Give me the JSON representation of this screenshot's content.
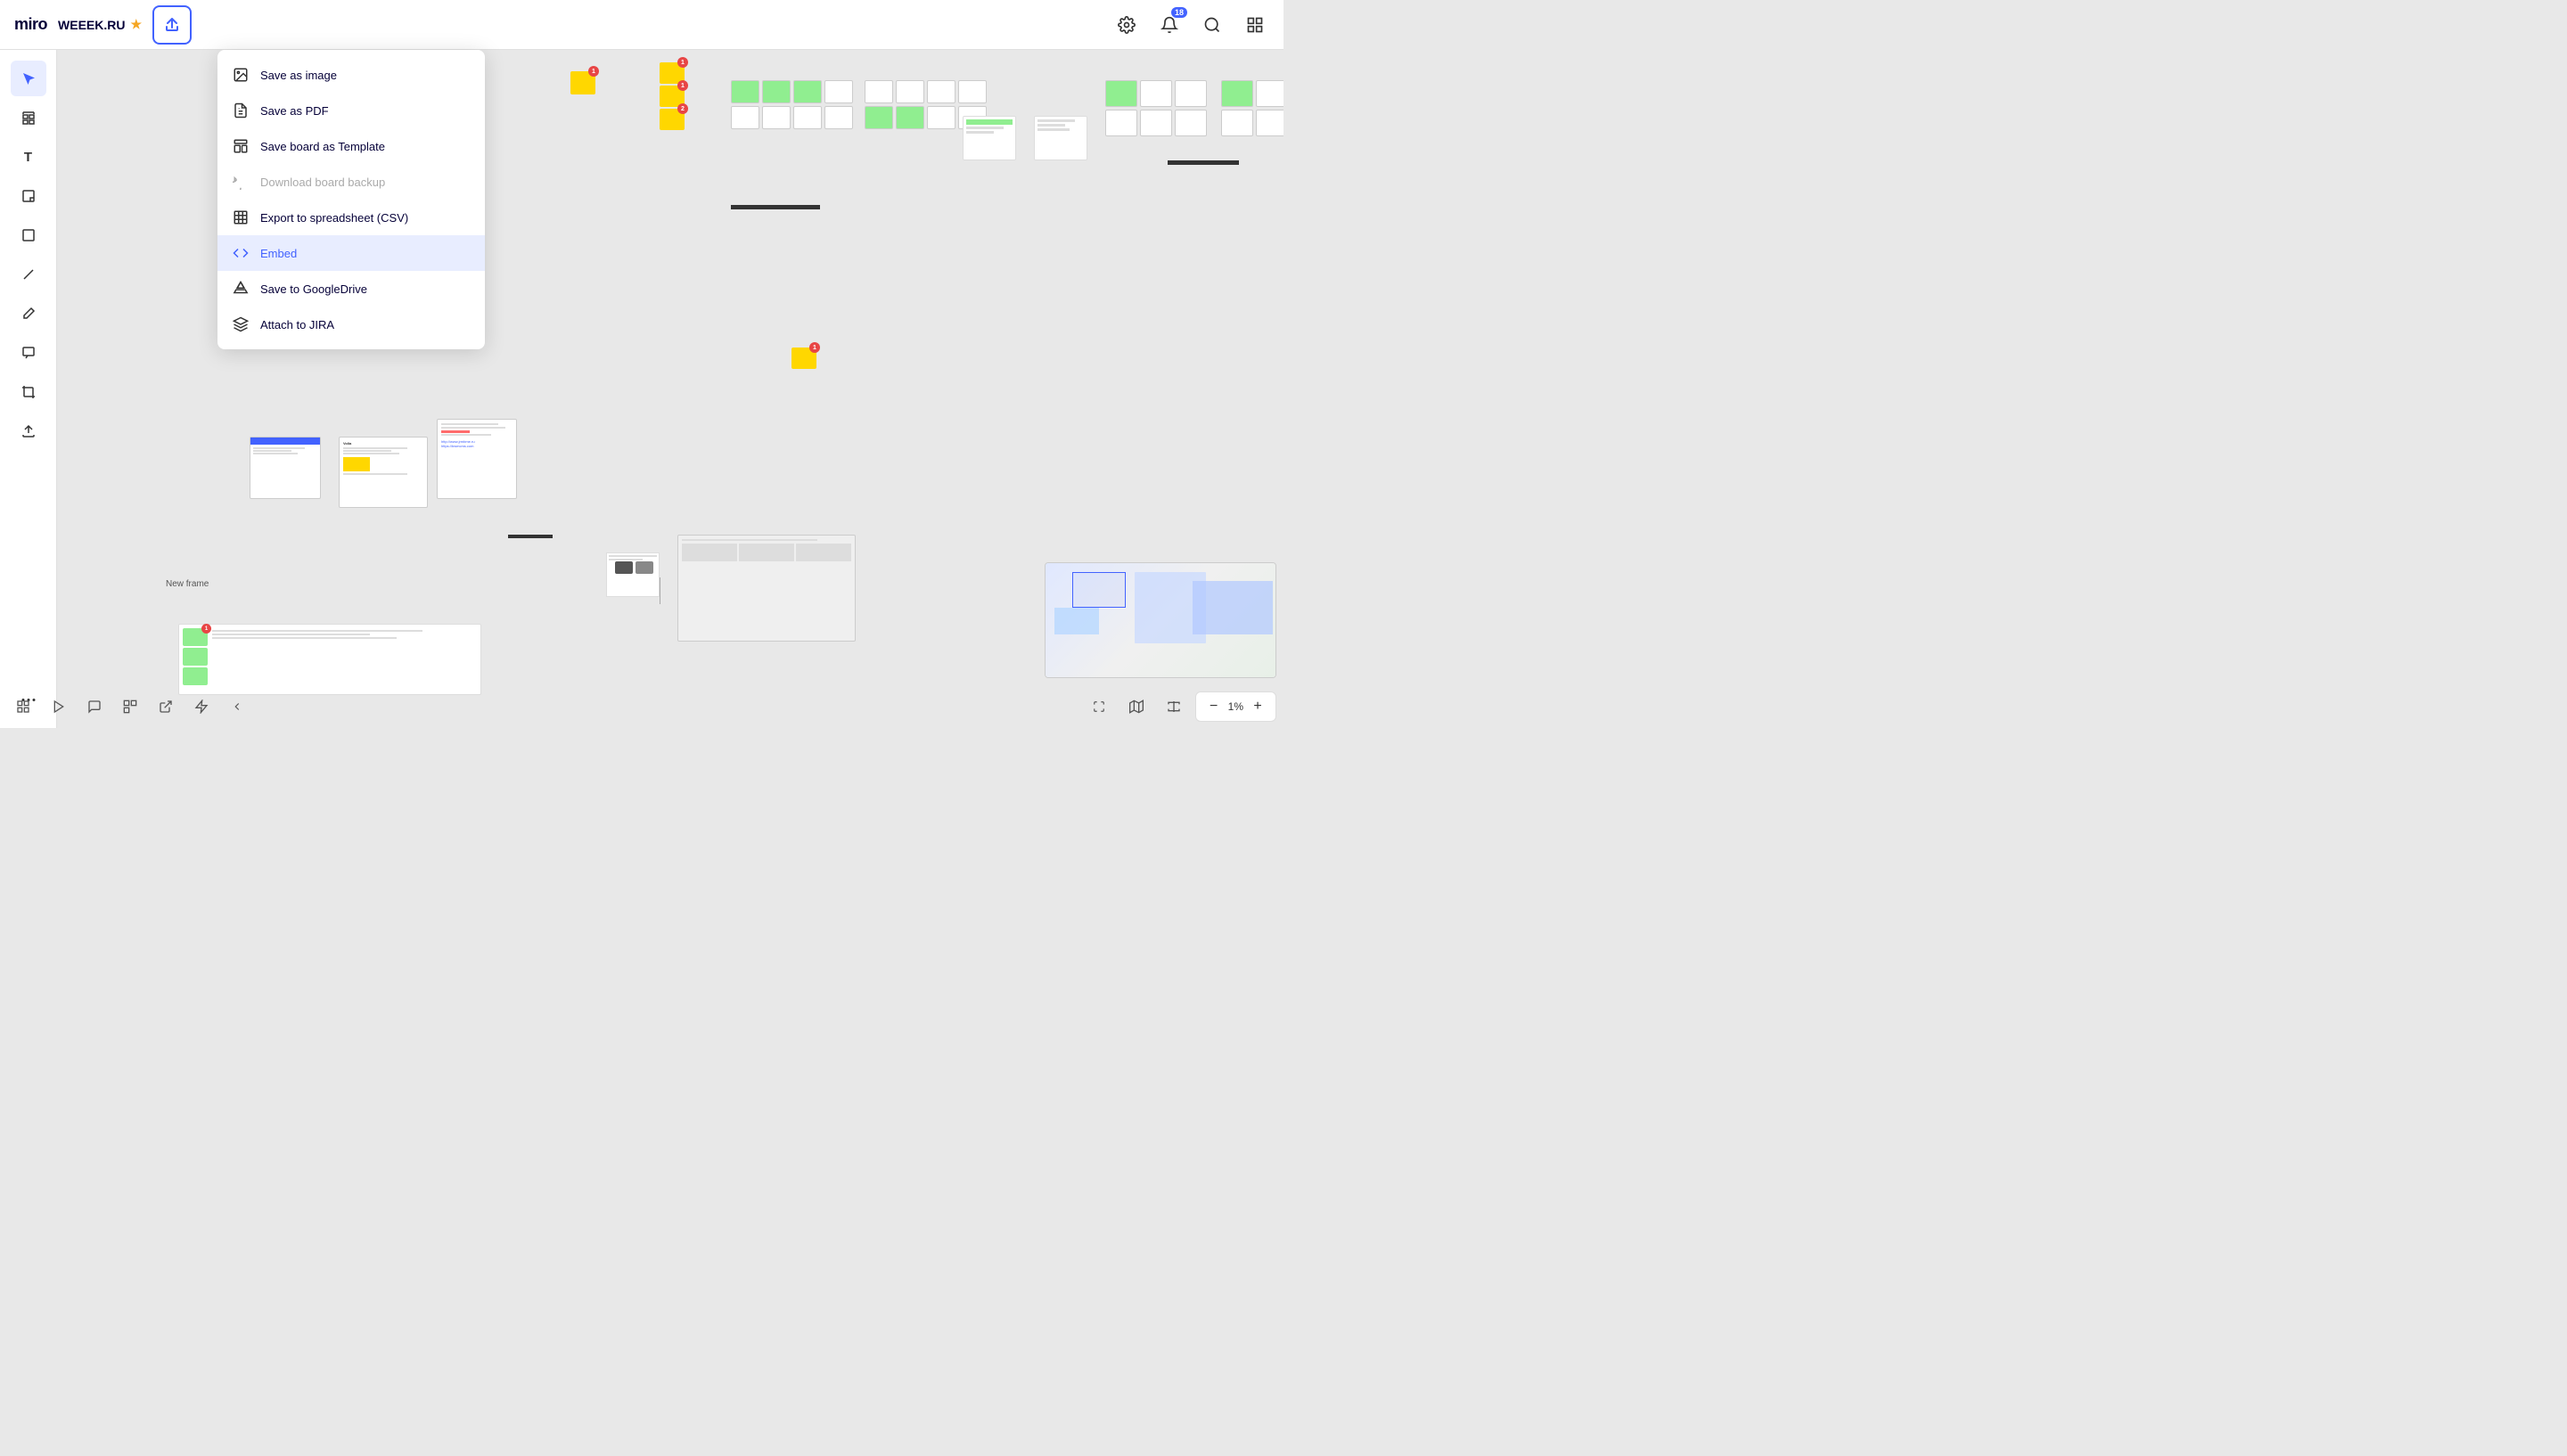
{
  "app": {
    "name": "miro"
  },
  "topbar": {
    "board_name": "WEEEK.RU",
    "share_icon": "↑",
    "settings_icon": "⚙",
    "notifications_icon": "🔔",
    "notifications_count": "18",
    "search_icon": "🔍",
    "menu_icon": "☰"
  },
  "dropdown": {
    "items": [
      {
        "id": "save-image",
        "label": "Save as image",
        "icon": "image",
        "disabled": false,
        "active": false
      },
      {
        "id": "save-pdf",
        "label": "Save as PDF",
        "icon": "pdf",
        "disabled": false,
        "active": false
      },
      {
        "id": "save-template",
        "label": "Save board as Template",
        "icon": "template",
        "disabled": false,
        "active": false
      },
      {
        "id": "download-backup",
        "label": "Download board backup",
        "icon": "backup",
        "disabled": true,
        "active": false
      },
      {
        "id": "export-csv",
        "label": "Export to spreadsheet (CSV)",
        "icon": "csv",
        "disabled": false,
        "active": false
      },
      {
        "id": "embed",
        "label": "Embed",
        "icon": "embed",
        "disabled": false,
        "active": true
      },
      {
        "id": "save-gdrive",
        "label": "Save to GoogleDrive",
        "icon": "gdrive",
        "disabled": false,
        "active": false
      },
      {
        "id": "attach-jira",
        "label": "Attach to JIRA",
        "icon": "jira",
        "disabled": false,
        "active": false
      }
    ]
  },
  "sidebar": {
    "tools": [
      {
        "id": "select",
        "icon": "▲",
        "label": "Select",
        "active": true
      },
      {
        "id": "frames",
        "icon": "▦",
        "label": "Frames",
        "active": false
      },
      {
        "id": "text",
        "icon": "T",
        "label": "Text",
        "active": false
      },
      {
        "id": "sticky",
        "icon": "📄",
        "label": "Sticky note",
        "active": false
      },
      {
        "id": "shapes",
        "icon": "□",
        "label": "Shapes",
        "active": false
      },
      {
        "id": "line",
        "icon": "/",
        "label": "Line",
        "active": false
      },
      {
        "id": "pen",
        "icon": "✏",
        "label": "Pen",
        "active": false
      },
      {
        "id": "chat",
        "icon": "💬",
        "label": "Chat",
        "active": false
      },
      {
        "id": "crop",
        "icon": "⊞",
        "label": "Crop",
        "active": false
      },
      {
        "id": "upload",
        "icon": "↑",
        "label": "Upload",
        "active": false
      },
      {
        "id": "more",
        "icon": "•••",
        "label": "More",
        "active": false
      }
    ]
  },
  "bottom_toolbar": {
    "tools": [
      "⊞",
      "▷",
      "💬",
      "⧉",
      "⚡",
      "⟨"
    ],
    "zoom_level": "1%",
    "zoom_fit_icon": "⊡",
    "map_icon": "🗺",
    "fit_icon": "⇔",
    "zoom_minus": "−",
    "zoom_plus": "+"
  },
  "frame_label": "New frame",
  "minimap": {
    "visible": true
  }
}
